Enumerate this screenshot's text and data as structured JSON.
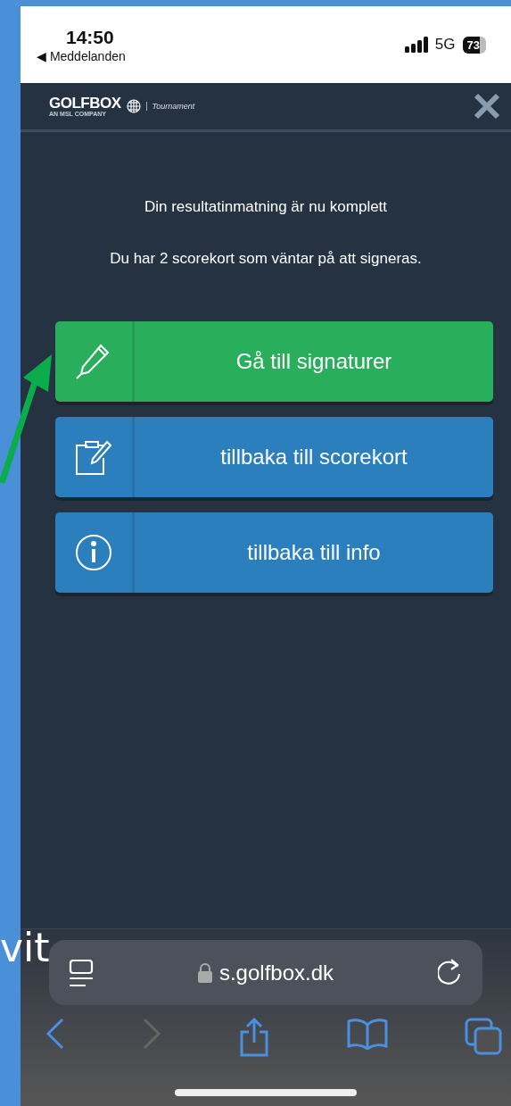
{
  "status_bar": {
    "time": "14:50",
    "back_label": "◀ Meddelanden",
    "network": "5G",
    "battery": "73"
  },
  "header": {
    "logo": "GOLFBOX",
    "logo_tagline": "AN MSL COMPANY",
    "product": "Tournament"
  },
  "messages": [
    "Din resultatinmatning är nu komplett",
    "Du har 2 scorekort som väntar på att signeras."
  ],
  "buttons": [
    {
      "label": "Gå till signaturer",
      "kind": "sign",
      "color": "#29ae5c"
    },
    {
      "label": "tillbaka till scorekort",
      "kind": "scorecard",
      "color": "#2b7fbc"
    },
    {
      "label": "tillbaka till info",
      "kind": "info",
      "color": "#2b7fbc"
    }
  ],
  "browser": {
    "url": "s.golfbox.dk",
    "back_disabled": false,
    "forward_disabled": true
  },
  "overlay_text": "vit"
}
